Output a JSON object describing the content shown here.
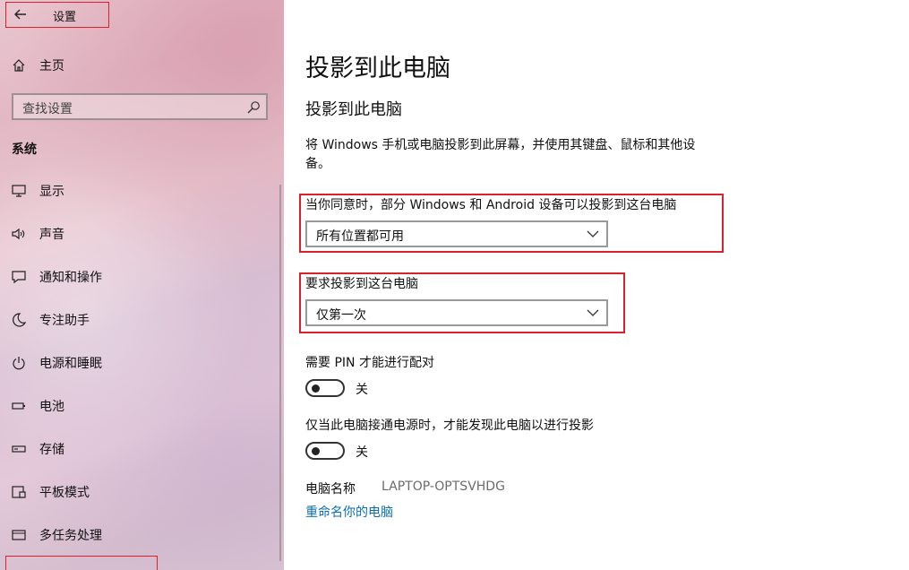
{
  "colors": {
    "highlight_border": "#e0202c",
    "link": "#0a6fb0",
    "secondary_text": "#6b6b6b"
  },
  "window": {
    "title": "设置",
    "back_icon": "arrow-left-icon"
  },
  "sidebar": {
    "home": {
      "label": "主页",
      "icon": "home-icon"
    },
    "search": {
      "placeholder": "查找设置",
      "icon": "search-icon"
    },
    "section": "系统",
    "items": [
      {
        "label": "显示",
        "icon": "monitor-icon"
      },
      {
        "label": "声音",
        "icon": "speaker-icon"
      },
      {
        "label": "通知和操作",
        "icon": "message-icon"
      },
      {
        "label": "专注助手",
        "icon": "moon-icon"
      },
      {
        "label": "电源和睡眠",
        "icon": "power-icon"
      },
      {
        "label": "电池",
        "icon": "battery-icon"
      },
      {
        "label": "存储",
        "icon": "storage-icon"
      },
      {
        "label": "平板模式",
        "icon": "tablet-icon"
      },
      {
        "label": "多任务处理",
        "icon": "multitask-icon"
      }
    ]
  },
  "main": {
    "page_title": "投影到此电脑",
    "sub_title": "投影到此电脑",
    "description": "将 Windows 手机或电脑投影到此屏幕，并使用其键盘、鼠标和其他设备。",
    "availability": {
      "label": "当你同意时，部分 Windows 和 Android 设备可以投影到这台电脑",
      "value": "所有位置都可用"
    },
    "ask_to_project": {
      "label": "要求投影到这台电脑",
      "value": "仅第一次"
    },
    "require_pin": {
      "label": "需要 PIN 才能进行配对",
      "state": "关"
    },
    "plugged_in_only": {
      "label": "仅当此电脑接通电源时，才能发现此电脑以进行投影",
      "state": "关"
    },
    "pc_name": {
      "label": "电脑名称",
      "value": "LAPTOP-OPTSVHDG"
    },
    "rename_link": "重命名你的电脑"
  }
}
